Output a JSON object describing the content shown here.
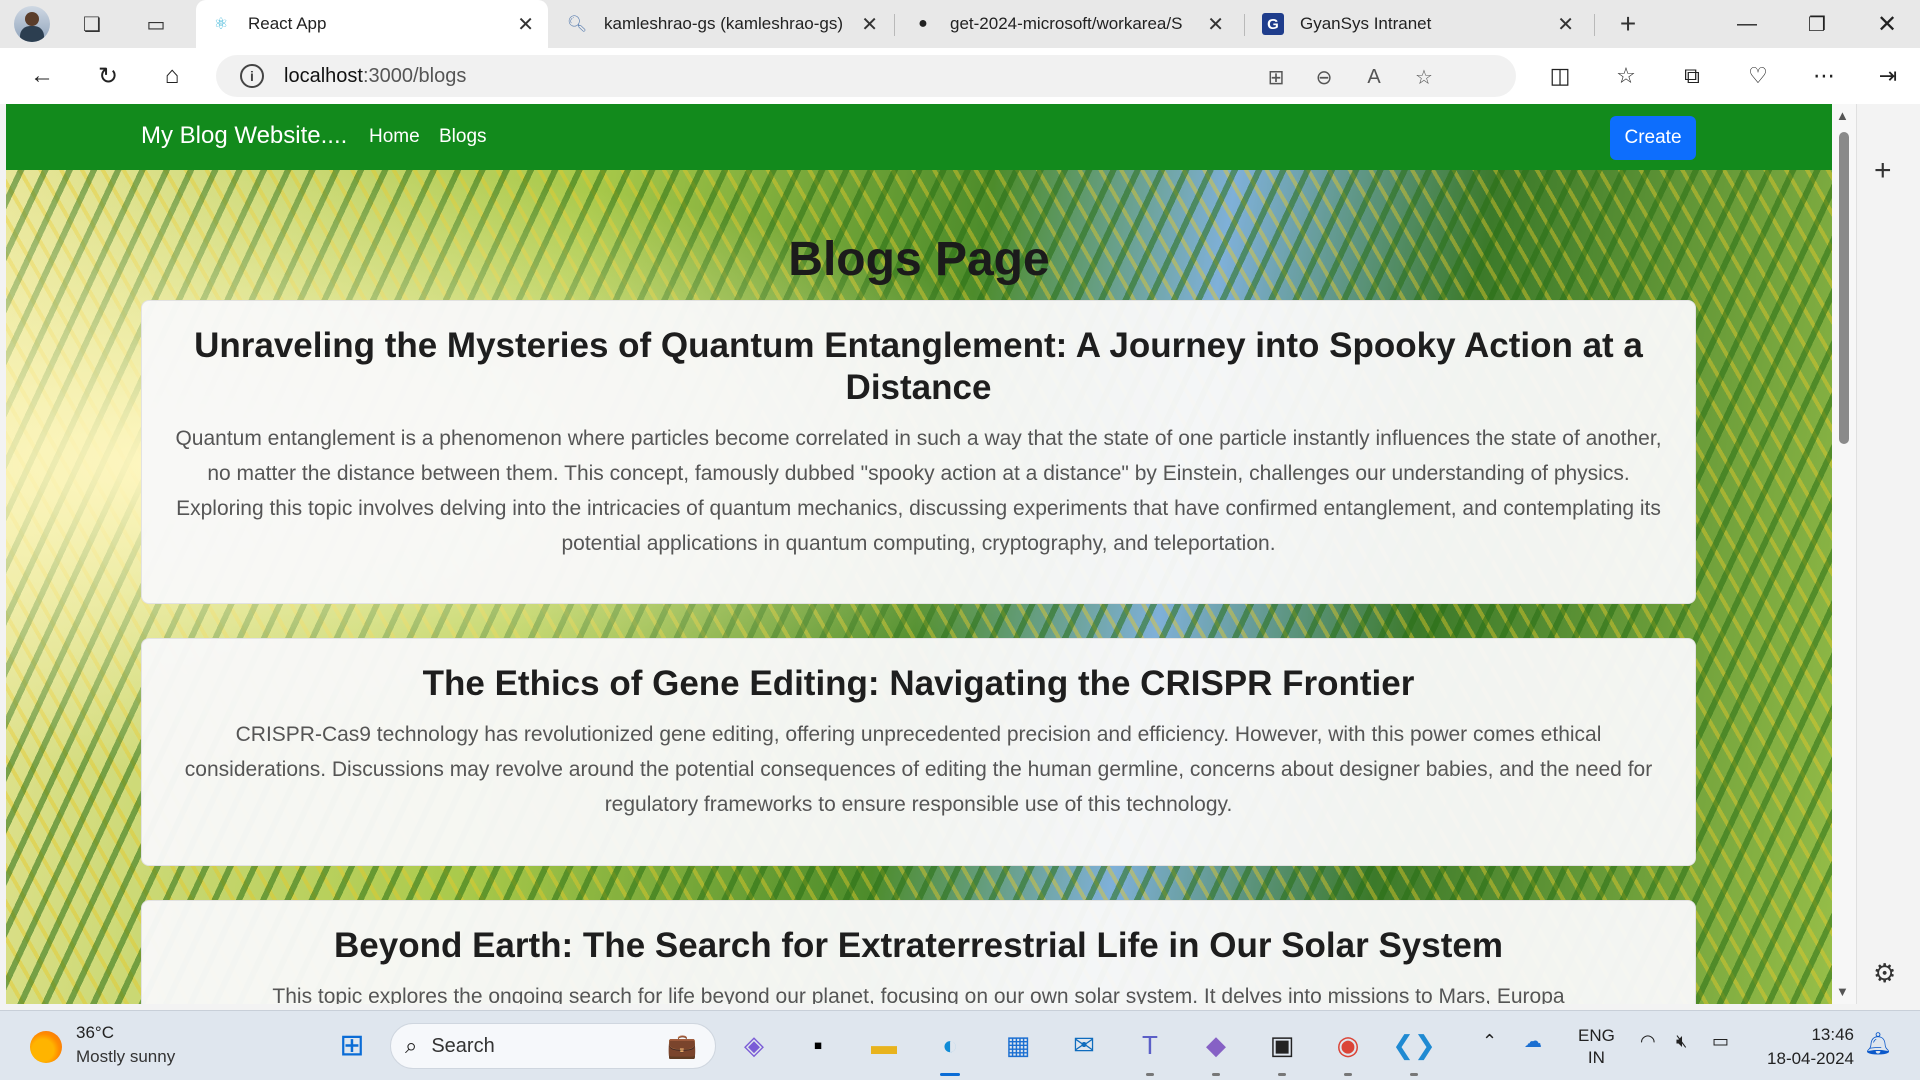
{
  "tabs": [
    {
      "title": "React App",
      "favicon": "react-icon",
      "active": true
    },
    {
      "title": "kamleshrao-gs (kamleshrao-gs)",
      "favicon": "search-icon",
      "active": false
    },
    {
      "title": "get-2024-microsoft/workarea/S",
      "favicon": "github-icon",
      "active": false
    },
    {
      "title": "GyanSys Intranet",
      "favicon": "gyansys-icon",
      "active": false
    }
  ],
  "address": {
    "host": "localhost",
    "path": ":3000/blogs"
  },
  "navbar": {
    "brand": "My Blog Website....",
    "links": [
      "Home",
      "Blogs"
    ],
    "create_label": "Create",
    "color": "#128a1c"
  },
  "page": {
    "heading": "Blogs Page"
  },
  "posts": [
    {
      "title": "Unraveling the Mysteries of Quantum Entanglement: A Journey into Spooky Action at a Distance",
      "body": "Quantum entanglement is a phenomenon where particles become correlated in such a way that the state of one particle instantly influences the state of another, no matter the distance between them. This concept, famously dubbed \"spooky action at a distance\" by Einstein, challenges our understanding of physics. Exploring this topic involves delving into the intricacies of quantum mechanics, discussing experiments that have confirmed entanglement, and contemplating its potential applications in quantum computing, cryptography, and teleportation."
    },
    {
      "title": "The Ethics of Gene Editing: Navigating the CRISPR Frontier",
      "body": "CRISPR-Cas9 technology has revolutionized gene editing, offering unprecedented precision and efficiency. However, with this power comes ethical considerations. Discussions may revolve around the potential consequences of editing the human germline, concerns about designer babies, and the need for regulatory frameworks to ensure responsible use of this technology."
    },
    {
      "title": "Beyond Earth: The Search for Extraterrestrial Life in Our Solar System",
      "body": "This topic explores the ongoing search for life beyond our planet, focusing on our own solar system. It delves into missions to Mars, Europa"
    }
  ],
  "taskbar": {
    "weather_temp": "36°C",
    "weather_desc": "Mostly sunny",
    "search_label": "Search",
    "lang_top": "ENG",
    "lang_bottom": "IN",
    "time": "13:46",
    "date": "18-04-2024"
  }
}
